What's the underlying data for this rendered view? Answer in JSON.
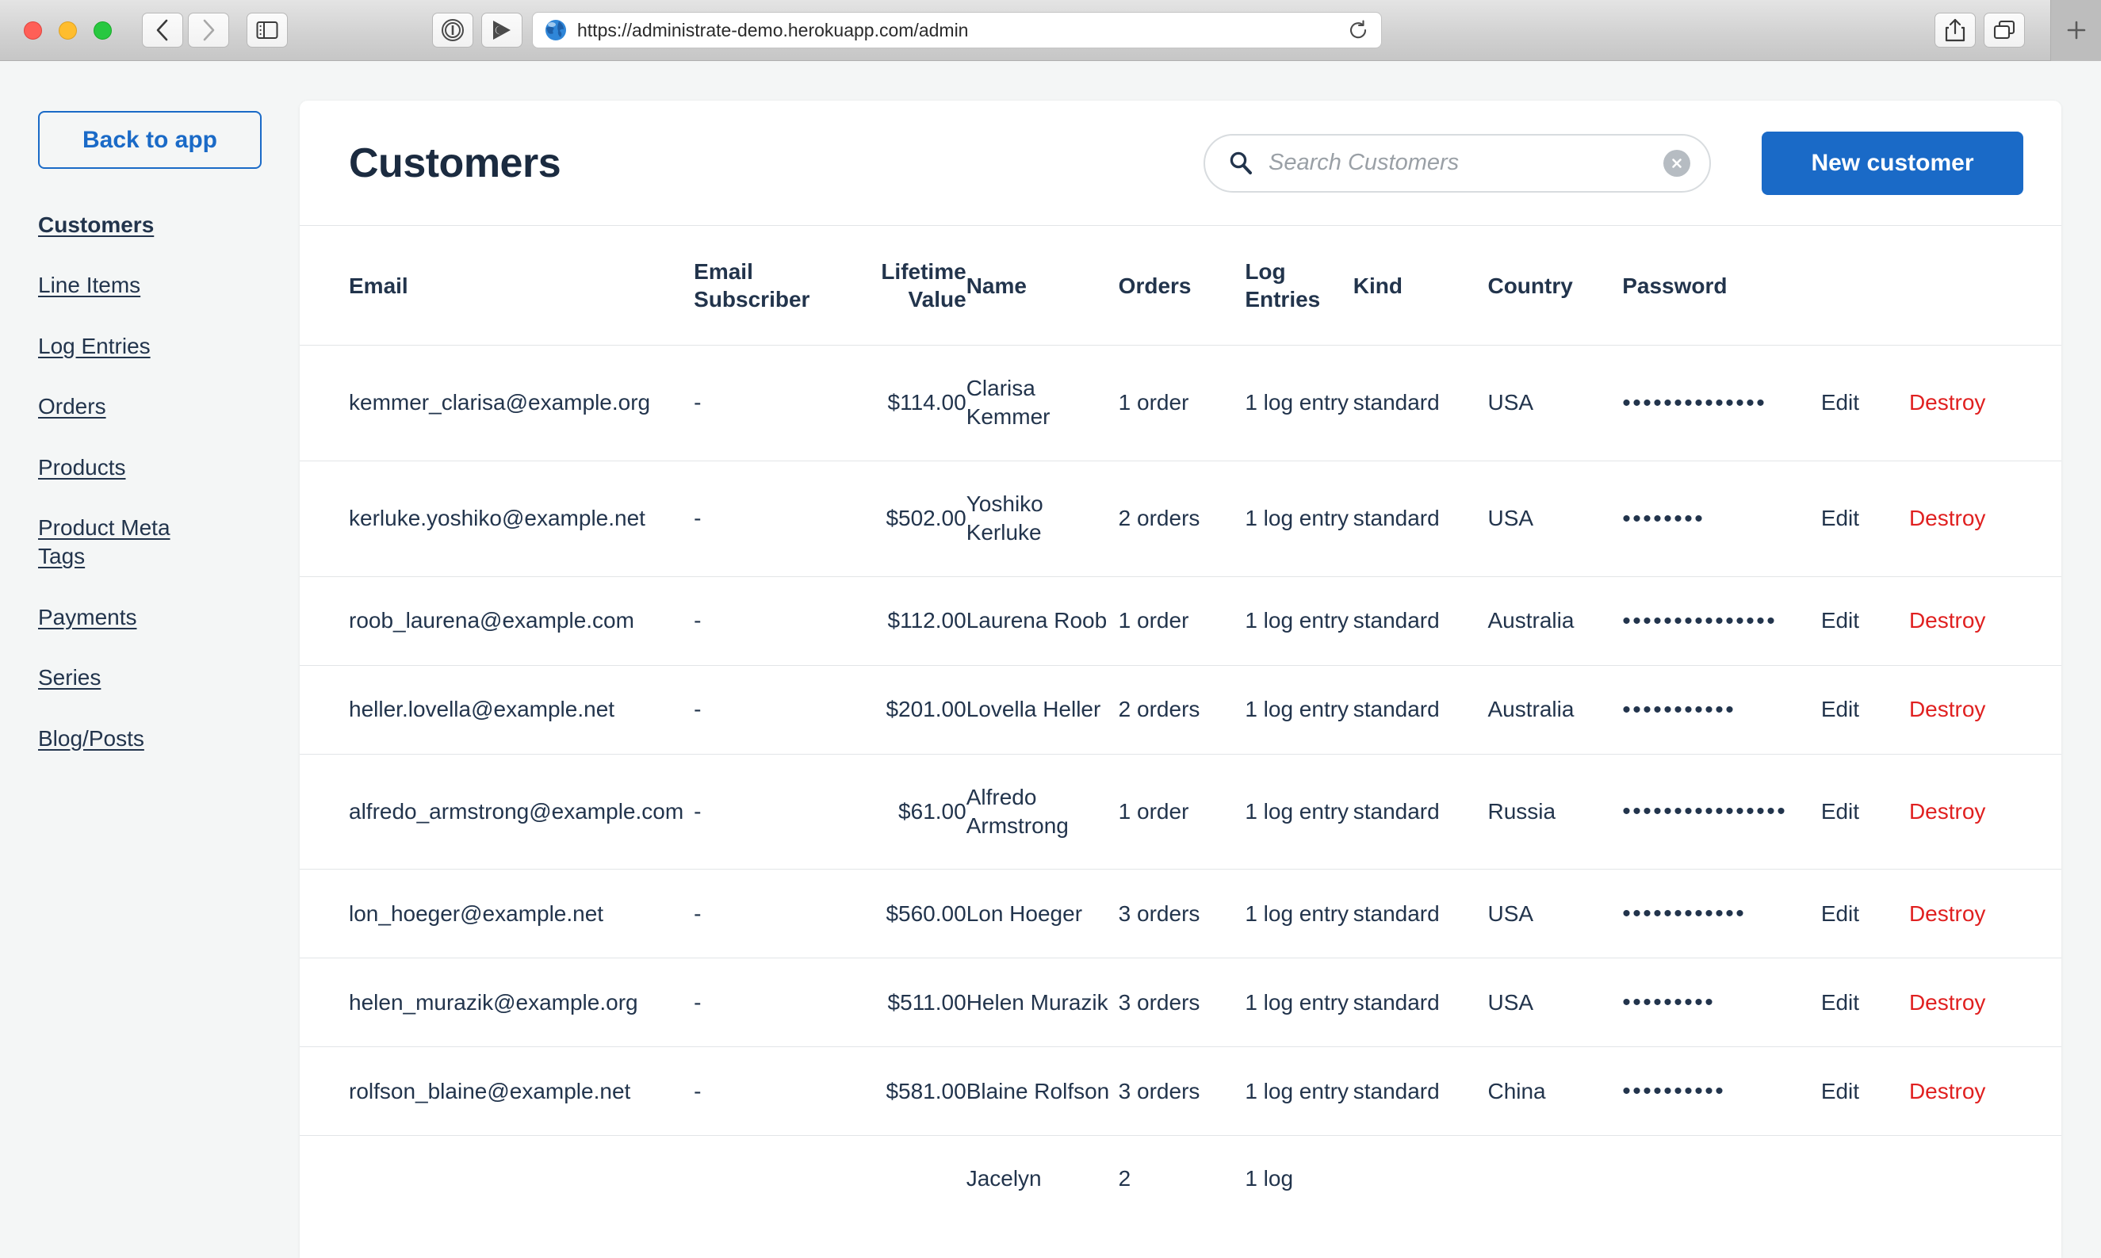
{
  "browser": {
    "url": "https://administrate-demo.herokuapp.com/admin",
    "nav_back_icon": "chevron-left-icon",
    "nav_forward_icon": "chevron-right-icon",
    "sidebar_toggle_icon": "sidebar-toggle-icon",
    "extension_1_icon": "onepassword-icon",
    "extension_2_icon": "play-circle-icon",
    "site_icon": "globe-icon",
    "reload_icon": "reload-icon",
    "share_icon": "share-icon",
    "tabs_icon": "tab-overview-icon",
    "new_tab_icon": "plus-icon"
  },
  "sidebar": {
    "back_to_app": "Back to app",
    "items": [
      {
        "label": "Customers",
        "active": true
      },
      {
        "label": "Line Items",
        "active": false
      },
      {
        "label": "Log Entries",
        "active": false
      },
      {
        "label": "Orders",
        "active": false
      },
      {
        "label": "Products",
        "active": false
      },
      {
        "label": "Product Meta Tags",
        "active": false
      },
      {
        "label": "Payments",
        "active": false
      },
      {
        "label": "Series",
        "active": false
      },
      {
        "label": "Blog/Posts",
        "active": false
      }
    ]
  },
  "header": {
    "title": "Customers",
    "search_placeholder": "Search Customers",
    "search_value": "",
    "search_icon": "search-icon",
    "clear_icon": "clear-circle-icon",
    "new_button": "New customer"
  },
  "colors": {
    "accent_blue": "#1a6ac7",
    "destroy_red": "#e02020",
    "text_navy": "#22344c",
    "page_bg": "#f4f6f6",
    "border": "#e2e5e7"
  },
  "table": {
    "columns": [
      "Email",
      "Email Subscriber",
      "Lifetime Value",
      "Name",
      "Orders",
      "Log Entries",
      "Kind",
      "Country",
      "Password",
      "",
      ""
    ],
    "actions": {
      "edit": "Edit",
      "destroy": "Destroy"
    },
    "rows": [
      {
        "email": "kemmer_clarisa@example.org",
        "email_subscriber": "-",
        "lifetime_value": "$114.00",
        "name": "Clarisa Kemmer",
        "orders": "1 order",
        "log_entries": "1 log entry",
        "kind": "standard",
        "country": "USA",
        "password_dots": 14
      },
      {
        "email": "kerluke.yoshiko@example.net",
        "email_subscriber": "-",
        "lifetime_value": "$502.00",
        "name": "Yoshiko Kerluke",
        "orders": "2 orders",
        "log_entries": "1 log entry",
        "kind": "standard",
        "country": "USA",
        "password_dots": 8
      },
      {
        "email": "roob_laurena@example.com",
        "email_subscriber": "-",
        "lifetime_value": "$112.00",
        "name": "Laurena Roob",
        "orders": "1 order",
        "log_entries": "1 log entry",
        "kind": "standard",
        "country": "Australia",
        "password_dots": 15
      },
      {
        "email": "heller.lovella@example.net",
        "email_subscriber": "-",
        "lifetime_value": "$201.00",
        "name": "Lovella Heller",
        "orders": "2 orders",
        "log_entries": "1 log entry",
        "kind": "standard",
        "country": "Australia",
        "password_dots": 11
      },
      {
        "email": "alfredo_armstrong@example.com",
        "email_subscriber": "-",
        "lifetime_value": "$61.00",
        "name": "Alfredo Armstrong",
        "orders": "1 order",
        "log_entries": "1 log entry",
        "kind": "standard",
        "country": "Russia",
        "password_dots": 16
      },
      {
        "email": "lon_hoeger@example.net",
        "email_subscriber": "-",
        "lifetime_value": "$560.00",
        "name": "Lon Hoeger",
        "orders": "3 orders",
        "log_entries": "1 log entry",
        "kind": "standard",
        "country": "USA",
        "password_dots": 12
      },
      {
        "email": "helen_murazik@example.org",
        "email_subscriber": "-",
        "lifetime_value": "$511.00",
        "name": "Helen Murazik",
        "orders": "3 orders",
        "log_entries": "1 log entry",
        "kind": "standard",
        "country": "USA",
        "password_dots": 9
      },
      {
        "email": "rolfson_blaine@example.net",
        "email_subscriber": "-",
        "lifetime_value": "$581.00",
        "name": "Blaine Rolfson",
        "orders": "3 orders",
        "log_entries": "1 log entry",
        "kind": "standard",
        "country": "China",
        "password_dots": 10
      },
      {
        "email": "",
        "email_subscriber": "",
        "lifetime_value": "",
        "name": "Jacelyn",
        "orders": "2",
        "log_entries": "1 log",
        "kind": "",
        "country": "",
        "password_dots": 0,
        "partial": true
      }
    ]
  }
}
